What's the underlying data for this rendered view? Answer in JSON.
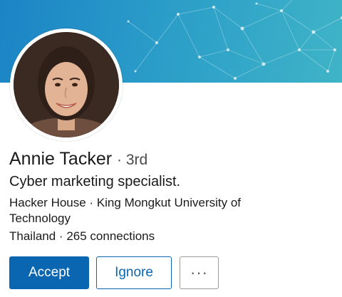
{
  "profile": {
    "name": "Annie Tacker",
    "degree": "· 3rd",
    "headline": "Cyber marketing specialist.",
    "organizations": "Hacker House · King Mongkut University of Technology",
    "location_connections": "Thailand · 265 connections"
  },
  "actions": {
    "accept_label": "Accept",
    "ignore_label": "Ignore",
    "more_label": "···"
  },
  "colors": {
    "banner": "#2a9cc8",
    "primary_button": "#0a66b0",
    "text": "#1a1a1a"
  },
  "icons": {
    "more": "more-options-icon"
  }
}
